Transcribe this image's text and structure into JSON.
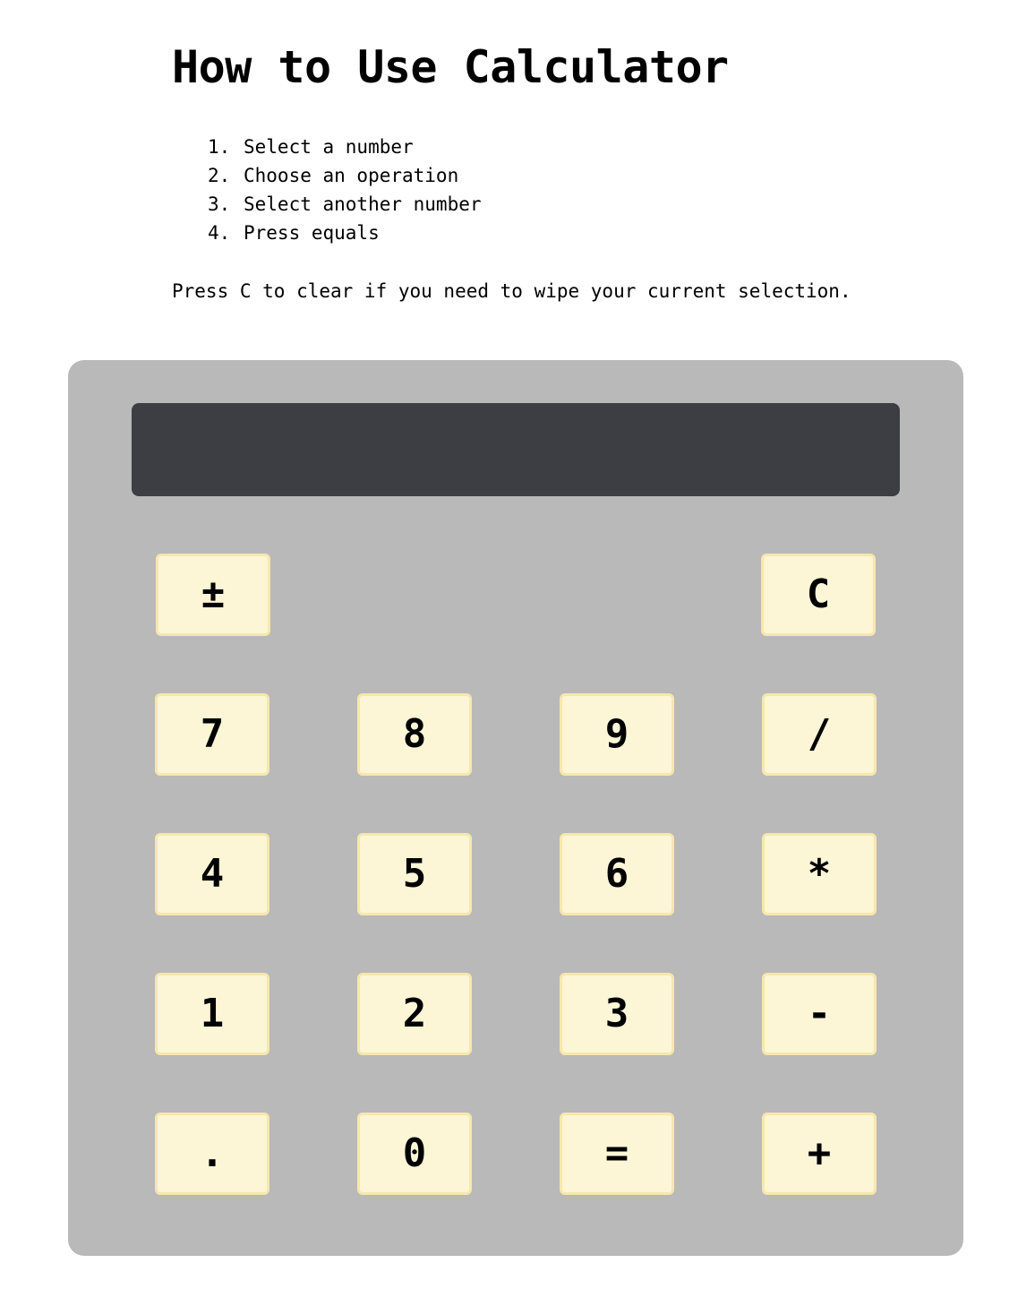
{
  "header": {
    "title": "How to Use Calculator"
  },
  "instructions": {
    "steps": [
      {
        "num": "1.",
        "text": "Select a number"
      },
      {
        "num": "2.",
        "text": "Choose an operation"
      },
      {
        "num": "3.",
        "text": "Select another number"
      },
      {
        "num": "4.",
        "text": "Press equals"
      }
    ],
    "clear_note": "Press C to clear if you need to wipe your current selection."
  },
  "calculator": {
    "display_value": "",
    "colors": {
      "body": "#b9b9b9",
      "display": "#3c3e43",
      "key": "#fcf6d6",
      "key_border": "#f6e7ad"
    },
    "keys": {
      "plus_minus": "±",
      "clear": "C",
      "seven": "7",
      "eight": "8",
      "nine": "9",
      "divide": "/",
      "four": "4",
      "five": "5",
      "six": "6",
      "multiply": "*",
      "one": "1",
      "two": "2",
      "three": "3",
      "subtract": "-",
      "decimal": ".",
      "zero": "0",
      "equals": "=",
      "add": "+"
    }
  }
}
